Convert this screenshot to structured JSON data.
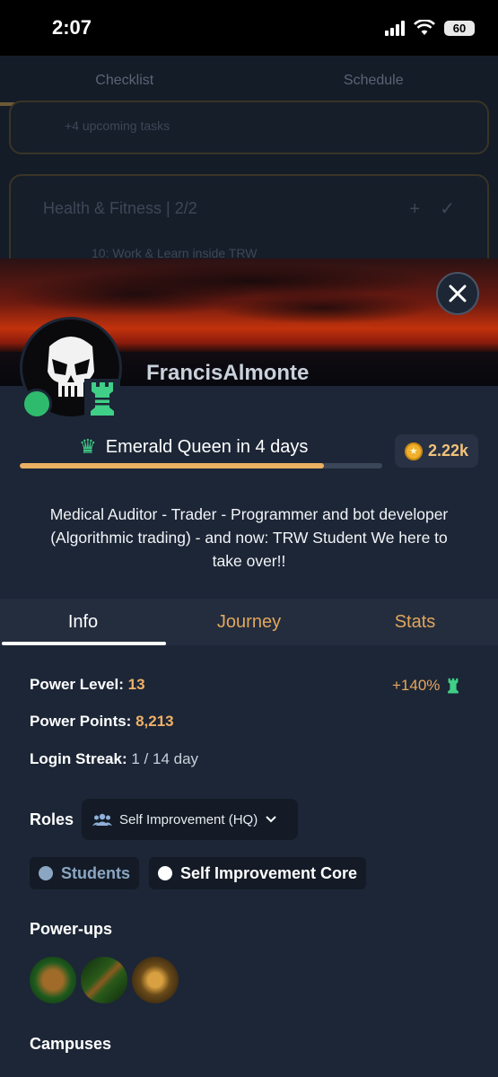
{
  "status_bar": {
    "time": "2:07",
    "battery": "60"
  },
  "background": {
    "tabs": [
      "Checklist",
      "Schedule"
    ],
    "card1_text": "+4 upcoming tasks",
    "card2_title": "Health & Fitness | 2/2",
    "card2_sub": "10: Work & Learn inside TRW"
  },
  "profile": {
    "username": "FrancisAlmonte",
    "rank_text": "Emerald Queen in 4 days",
    "rank_progress": 0.84,
    "coins": "2.22k",
    "bio": "Medical Auditor - Trader - Programmer and bot developer (Algorithmic trading) - and now: TRW Student We here to take over!!"
  },
  "tabs": [
    "Info",
    "Journey",
    "Stats"
  ],
  "info": {
    "power_level_label": "Power Level:",
    "power_level": "13",
    "boost": "+140%",
    "power_points_label": "Power Points:",
    "power_points": "8,213",
    "login_streak_label": "Login Streak:",
    "login_streak": "1 / 14 day",
    "roles_label": "Roles",
    "roles_selected": "Self Improvement (HQ)",
    "role_pills": [
      "Students",
      "Self Improvement Core"
    ],
    "powerups_label": "Power-ups",
    "campuses_label": "Campuses"
  },
  "colors": {
    "accent": "#e3a65c",
    "emerald": "#3fcf87",
    "online": "#2fbb6e",
    "panel": "#1c2636"
  }
}
